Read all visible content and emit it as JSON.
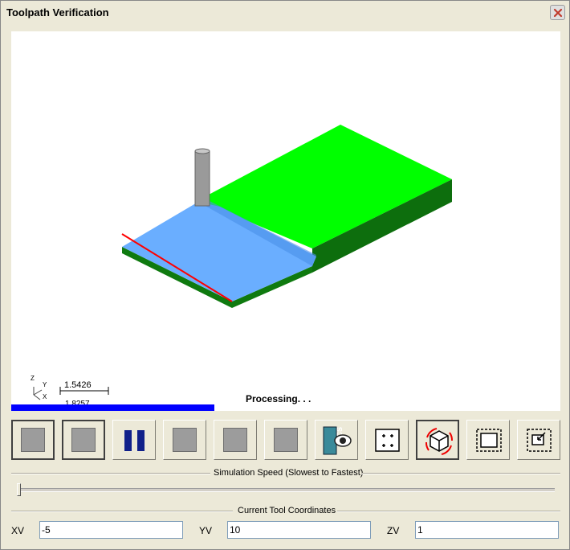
{
  "window": {
    "title": "Toolpath Verification",
    "close_icon": "close-icon"
  },
  "viewport": {
    "status": "Processing. . .",
    "scale": "1.5426",
    "scale_secondary": "1.8257",
    "axis_labels": {
      "z": "Z",
      "y": "Y",
      "x": "X"
    },
    "colors": {
      "stock_top": "#00ff00",
      "stock_side": "#0f7a0f",
      "machined": "#6aaeff",
      "toolpath": "#ff0000",
      "progress": "#0000ff"
    }
  },
  "toolbar": {
    "buttons": [
      {
        "name": "stop-button",
        "icon": "square-icon",
        "pressed": true
      },
      {
        "name": "step-back-button",
        "icon": "square-icon",
        "pressed": true
      },
      {
        "name": "pause-button",
        "icon": "pause-icon",
        "pressed": false
      },
      {
        "name": "step-button",
        "icon": "square-icon",
        "pressed": false
      },
      {
        "name": "step-forward-button",
        "icon": "square-icon",
        "pressed": false
      },
      {
        "name": "end-button",
        "icon": "square-icon",
        "pressed": false
      },
      {
        "name": "wcs-view-button",
        "icon": "wcs-eye-icon",
        "pressed": false
      },
      {
        "name": "fit-view-button",
        "icon": "fit-icon",
        "pressed": false
      },
      {
        "name": "rotate-view-button",
        "icon": "rotate-cube-icon",
        "pressed": true
      },
      {
        "name": "zoom-window-button",
        "icon": "zoom-window-icon",
        "pressed": false
      },
      {
        "name": "zoom-out-button",
        "icon": "zoom-out-icon",
        "pressed": false
      }
    ]
  },
  "simulation": {
    "label": "Simulation Speed (Slowest to Fastest)",
    "speed": 0
  },
  "coordinates": {
    "label": "Current Tool Coordinates",
    "xv_label": "XV",
    "xv": "-5",
    "yv_label": "YV",
    "yv": "10",
    "zv_label": "ZV",
    "zv": "1"
  }
}
